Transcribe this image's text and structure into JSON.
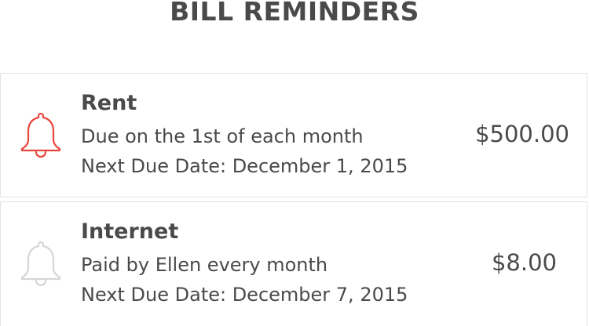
{
  "header": {
    "title": "BILL REMINDERS"
  },
  "reminders": [
    {
      "name": "Rent",
      "description": "Due on the 1st of each month",
      "next_due": "Next Due Date: December 1, 2015",
      "amount": "$500.00",
      "icon": "bell-icon",
      "icon_color": "#e8453c",
      "active": true
    },
    {
      "name": "Internet",
      "description": "Paid by Ellen every month",
      "next_due": "Next Due Date: December 7, 2015",
      "amount": "$8.00",
      "icon": "bell-icon",
      "icon_color": "#d6d6d6",
      "active": false
    }
  ]
}
